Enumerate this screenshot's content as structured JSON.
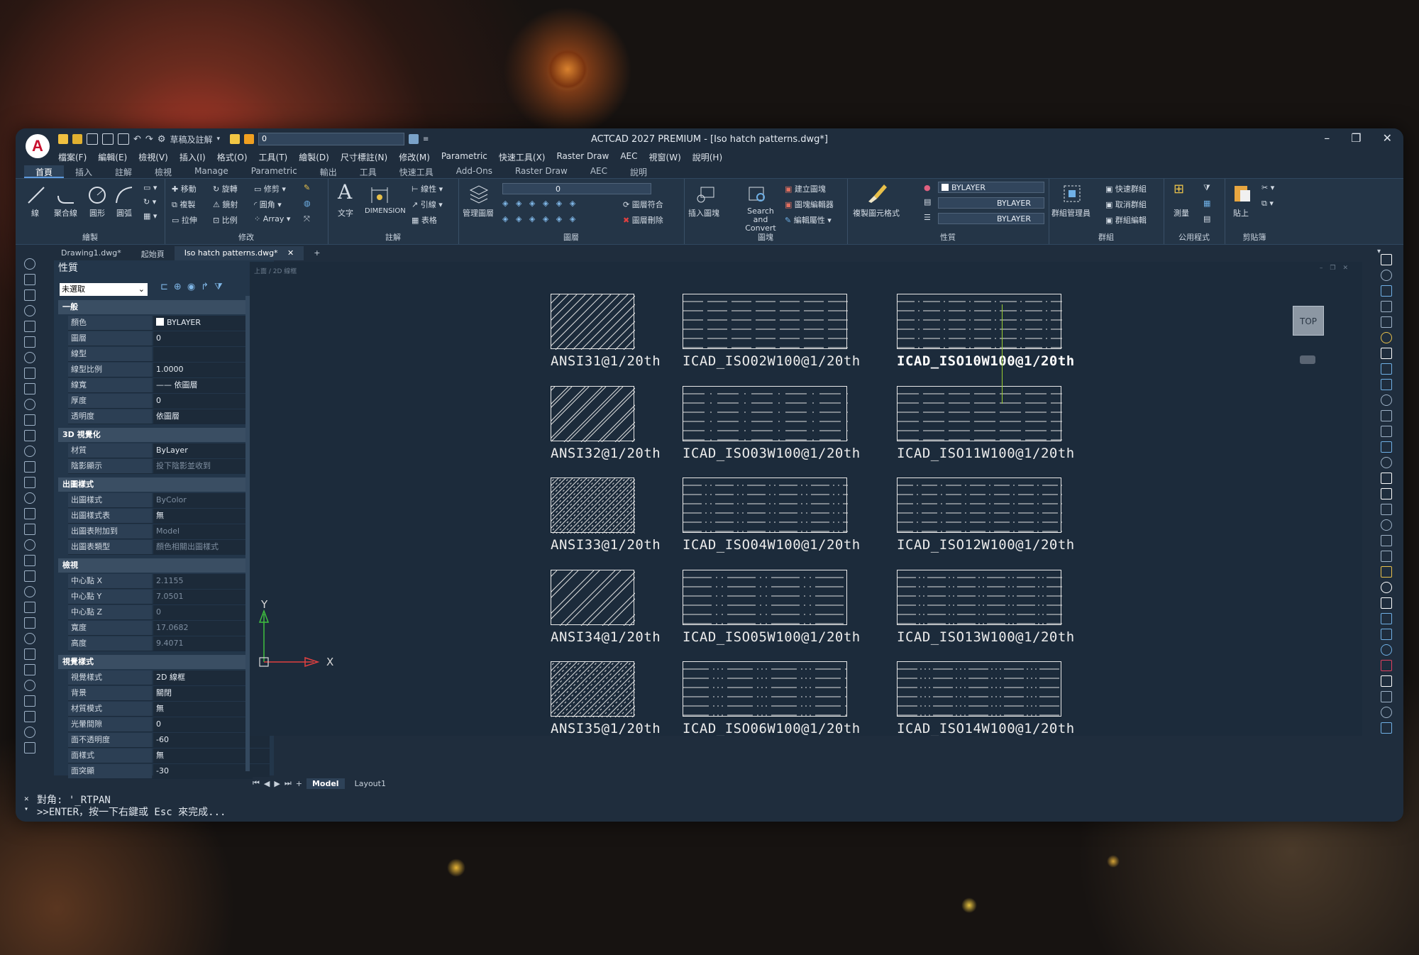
{
  "window": {
    "title": "ACTCAD 2027 PREMIUM - [Iso hatch patterns.dwg*]",
    "logo": "A",
    "workspace": "草稿及註解",
    "layer_value": "0"
  },
  "menubar": [
    "檔案(F)",
    "編輯(E)",
    "檢視(V)",
    "插入(I)",
    "格式(O)",
    "工具(T)",
    "繪製(D)",
    "尺寸標註(N)",
    "修改(M)",
    "Parametric",
    "快速工具(X)",
    "Raster Draw",
    "AEC",
    "視窗(W)",
    "說明(H)"
  ],
  "ribbon_tabs": [
    "首頁",
    "插入",
    "註解",
    "檢視",
    "Manage",
    "Parametric",
    "輸出",
    "工具",
    "快速工具",
    "Add-Ons",
    "Raster Draw",
    "AEC",
    "說明"
  ],
  "ribbon": {
    "draw": {
      "label": "繪製",
      "line": "線",
      "polyline": "聚合線",
      "circle": "圓形",
      "arc": "圓弧"
    },
    "modify": {
      "label": "修改",
      "move": "移動",
      "rotate": "旋轉",
      "trim": "修剪",
      "copy": "複製",
      "mirror": "鏡射",
      "fillet": "圓角",
      "stretch": "拉伸",
      "scale": "比例",
      "array": "Array"
    },
    "annotation": {
      "label": "註解",
      "text": "文字",
      "dimension": "DIMENSION",
      "linear": "線性",
      "leader": "引線",
      "table": "表格"
    },
    "layers": {
      "label": "圖層",
      "manager": "管理圖層",
      "layer_value": "0",
      "match": "圖層符合",
      "delete": "圖層刪除"
    },
    "block": {
      "label": "圖塊",
      "insert": "插入圖塊",
      "search": "Search and Convert",
      "create": "建立圖塊",
      "editor": "圖塊編輯器",
      "edit_attr": "編輯屬性"
    },
    "properties": {
      "label": "性質",
      "match": "複製圖元格式",
      "color": "BYLAYER",
      "linetype": "BYLAYER",
      "lineweight": "BYLAYER"
    },
    "groups": {
      "label": "群組",
      "manager": "群組管理員",
      "quick": "快速群組",
      "ungroup": "取消群組",
      "edit": "群組編輯"
    },
    "utilities": {
      "label": "公用程式",
      "measure": "測量"
    },
    "clipboard": {
      "label": "剪貼簿",
      "paste": "貼上"
    }
  },
  "doc_tabs": [
    "Drawing1.dwg*",
    "起始頁",
    "Iso hatch patterns.dwg*"
  ],
  "properties_panel": {
    "title": "性質",
    "selection": "未選取",
    "sections": [
      {
        "name": "一般",
        "rows": [
          [
            "顏色",
            "BYLAYER"
          ],
          [
            "圖層",
            "0"
          ],
          [
            "線型",
            ""
          ],
          [
            "線型比例",
            "1.0000"
          ],
          [
            "線寬",
            "—— 依圖層"
          ],
          [
            "厚度",
            "0"
          ],
          [
            "透明度",
            "依圖層"
          ]
        ]
      },
      {
        "name": "3D 視覺化",
        "rows": [
          [
            "材質",
            "ByLayer"
          ],
          [
            "陰影顯示",
            "投下陰影並收到"
          ]
        ]
      },
      {
        "name": "出圖樣式",
        "rows": [
          [
            "出圖樣式",
            "ByColor"
          ],
          [
            "出圖樣式表",
            "無"
          ],
          [
            "出圖表附加到",
            "Model"
          ],
          [
            "出圖表類型",
            "顏色相關出圖樣式"
          ]
        ]
      },
      {
        "name": "檢視",
        "rows": [
          [
            "中心點 X",
            "2.1155"
          ],
          [
            "中心點 Y",
            "7.0501"
          ],
          [
            "中心點 Z",
            "0"
          ],
          [
            "寬度",
            "17.0682"
          ],
          [
            "高度",
            "9.4071"
          ]
        ]
      },
      {
        "name": "視覺樣式",
        "rows": [
          [
            "視覺樣式",
            "2D 線框"
          ],
          [
            "背景",
            "關閉"
          ],
          [
            "材質模式",
            "無"
          ],
          [
            "光暈間隙",
            "0"
          ],
          [
            "面不透明度",
            "-60"
          ],
          [
            "面樣式",
            "無"
          ],
          [
            "面突顯",
            "-30"
          ]
        ]
      }
    ]
  },
  "viewport": {
    "label": "上面 / 2D 線框",
    "viewcube": "TOP",
    "ucs_x": "X",
    "ucs_y": "Y",
    "patterns": [
      [
        "ANSI31@1/20th",
        "ICAD_ISO02W100@1/20th",
        "ICAD_ISO10W100@1/20th"
      ],
      [
        "ANSI32@1/20th",
        "ICAD_ISO03W100@1/20th",
        "ICAD_ISO11W100@1/20th"
      ],
      [
        "ANSI33@1/20th",
        "ICAD_ISO04W100@1/20th",
        "ICAD_ISO12W100@1/20th"
      ],
      [
        "ANSI34@1/20th",
        "ICAD_ISO05W100@1/20th",
        "ICAD_ISO13W100@1/20th"
      ],
      [
        "ANSI35@1/20th",
        "ICAD_ISO06W100@1/20th",
        "ICAD_ISO14W100@1/20th"
      ]
    ]
  },
  "layout_tabs": [
    "Model",
    "Layout1"
  ],
  "command": {
    "line1": "對角: '_RTPAN",
    "line2": ">>ENTER，按一下右鍵或 Esc 來完成..."
  }
}
